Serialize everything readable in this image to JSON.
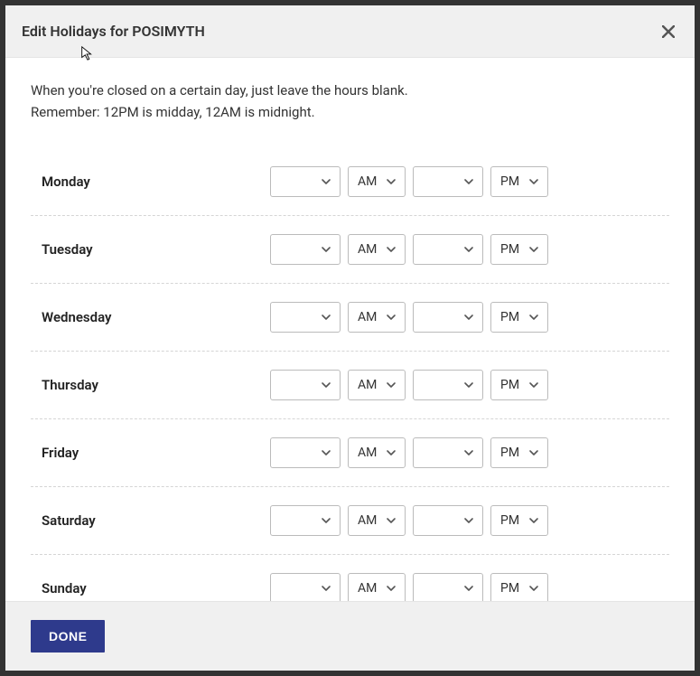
{
  "header": {
    "title": "Edit Holidays for POSIMYTH"
  },
  "instructions": {
    "line1": "When you're closed on a certain day, just leave the hours blank.",
    "line2": "Remember: 12PM is midday, 12AM is midnight."
  },
  "days": [
    {
      "label": "Monday",
      "open_hour": "",
      "open_period": "AM",
      "close_hour": "",
      "close_period": "PM"
    },
    {
      "label": "Tuesday",
      "open_hour": "",
      "open_period": "AM",
      "close_hour": "",
      "close_period": "PM"
    },
    {
      "label": "Wednesday",
      "open_hour": "",
      "open_period": "AM",
      "close_hour": "",
      "close_period": "PM"
    },
    {
      "label": "Thursday",
      "open_hour": "",
      "open_period": "AM",
      "close_hour": "",
      "close_period": "PM"
    },
    {
      "label": "Friday",
      "open_hour": "",
      "open_period": "AM",
      "close_hour": "",
      "close_period": "PM"
    },
    {
      "label": "Saturday",
      "open_hour": "",
      "open_period": "AM",
      "close_hour": "",
      "close_period": "PM"
    },
    {
      "label": "Sunday",
      "open_hour": "",
      "open_period": "AM",
      "close_hour": "",
      "close_period": "PM"
    }
  ],
  "footer": {
    "done_label": "DONE"
  }
}
